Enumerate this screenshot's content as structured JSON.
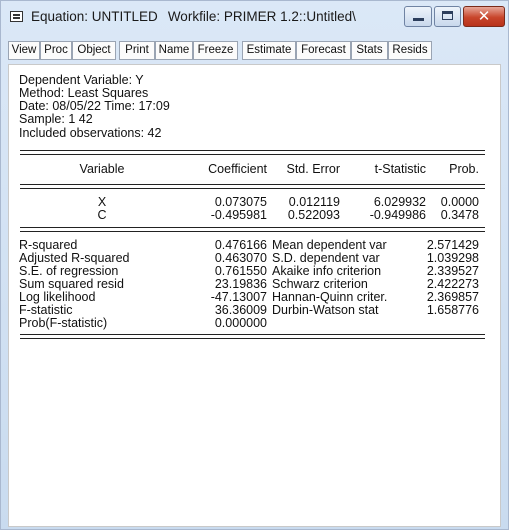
{
  "title": {
    "equation": "Equation: UNTITLED",
    "workfile": "Workfile: PRIMER 1.2::Untitled\\"
  },
  "window_controls": {
    "minimize_icon": "minimize-icon",
    "maximize_icon": "maximize-icon",
    "close_icon": "close-icon",
    "close_glyph": "✕"
  },
  "toolbar": [
    "View",
    "Proc",
    "Object",
    "Print",
    "Name",
    "Freeze",
    "Estimate",
    "Forecast",
    "Stats",
    "Resids"
  ],
  "header": {
    "dependent": "Dependent Variable: Y",
    "method": "Method: Least Squares",
    "date": "Date: 08/05/22   Time: 17:09",
    "sample": "Sample: 1 42",
    "observations": "Included observations: 42"
  },
  "columns": [
    "Variable",
    "Coefficient",
    "Std. Error",
    "t-Statistic",
    "Prob."
  ],
  "rows": [
    {
      "variable": "X",
      "coefficient": "0.073075",
      "std_error": "0.012119",
      "t_stat": "6.029932",
      "prob": "0.0000"
    },
    {
      "variable": "C",
      "coefficient": "-0.495981",
      "std_error": "0.522093",
      "t_stat": "-0.949986",
      "prob": "0.3478"
    }
  ],
  "stats_left": [
    {
      "label": "R-squared",
      "value": "0.476166"
    },
    {
      "label": "Adjusted R-squared",
      "value": "0.463070"
    },
    {
      "label": "S.E. of regression",
      "value": "0.761550"
    },
    {
      "label": "Sum squared resid",
      "value": "23.19836"
    },
    {
      "label": "Log likelihood",
      "value": "-47.13007"
    },
    {
      "label": "F-statistic",
      "value": "36.36009"
    },
    {
      "label": "Prob(F-statistic)",
      "value": "0.000000"
    }
  ],
  "stats_right": [
    {
      "label": "Mean dependent var",
      "value": "2.571429"
    },
    {
      "label": "S.D. dependent var",
      "value": "1.039298"
    },
    {
      "label": "Akaike info criterion",
      "value": "2.339527"
    },
    {
      "label": "Schwarz criterion",
      "value": "2.422273"
    },
    {
      "label": "Hannan-Quinn criter.",
      "value": "2.369857"
    },
    {
      "label": "Durbin-Watson stat",
      "value": "1.658776"
    }
  ]
}
